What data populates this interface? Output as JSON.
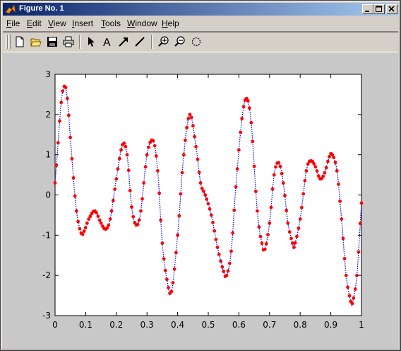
{
  "window": {
    "title": "Figure No. 1",
    "controls": [
      "minimize",
      "maximize",
      "close"
    ]
  },
  "menu": [
    {
      "label": "File",
      "mnemonic": "F",
      "rest": "ile"
    },
    {
      "label": "Edit",
      "mnemonic": "E",
      "rest": "dit"
    },
    {
      "label": "View",
      "mnemonic": "V",
      "rest": "iew"
    },
    {
      "label": "Insert",
      "mnemonic": "I",
      "rest": "nsert"
    },
    {
      "label": "Tools",
      "mnemonic": "T",
      "rest": "ools"
    },
    {
      "label": "Window",
      "mnemonic": "W",
      "rest": "indow"
    },
    {
      "label": "Help",
      "mnemonic": "H",
      "rest": "elp"
    }
  ],
  "toolbar": {
    "buttons": [
      "new-file-icon",
      "open-folder-icon",
      "save-icon",
      "print-icon",
      "select-arrow-icon",
      "insert-text-icon",
      "insert-arrow-icon",
      "insert-line-icon",
      "zoom-in-icon",
      "zoom-out-icon",
      "rotate-icon"
    ],
    "text_tool_glyph": "A"
  },
  "colors": {
    "marker": "#ff0000",
    "line": "#0000ff",
    "title_bar_start": "#0a246a",
    "title_bar_end": "#a6caf0",
    "face": "#d4d0c8",
    "figure_bg": "#c8c8c8"
  },
  "chart_data": {
    "type": "line",
    "xlim": [
      0,
      1
    ],
    "ylim": [
      -3,
      3
    ],
    "x_ticks": [
      "0",
      "0.1",
      "0.2",
      "0.3",
      "0.4",
      "0.5",
      "0.6",
      "0.7",
      "0.8",
      "0.9",
      "1"
    ],
    "y_ticks": [
      "3",
      "2",
      "1",
      "0",
      "-1",
      "-2",
      "-3"
    ],
    "grid": false,
    "series": [
      {
        "style": "blue dotted line with red circle markers",
        "x": [
          0.0,
          0.01,
          0.02,
          0.03,
          0.04,
          0.055,
          0.07,
          0.085,
          0.095,
          0.11,
          0.13,
          0.15,
          0.165,
          0.18,
          0.2,
          0.22,
          0.235,
          0.25,
          0.265,
          0.28,
          0.3,
          0.32,
          0.335,
          0.35,
          0.365,
          0.38,
          0.4,
          0.42,
          0.44,
          0.46,
          0.475,
          0.49,
          0.51,
          0.53,
          0.55,
          0.56,
          0.575,
          0.59,
          0.61,
          0.625,
          0.64,
          0.66,
          0.675,
          0.685,
          0.7,
          0.715,
          0.73,
          0.745,
          0.76,
          0.775,
          0.78,
          0.8,
          0.82,
          0.835,
          0.85,
          0.865,
          0.88,
          0.895,
          0.905,
          0.92,
          0.935,
          0.95,
          0.965,
          0.97,
          0.985,
          1.0
        ],
        "y": [
          0.3,
          1.3,
          2.3,
          2.7,
          2.4,
          0.9,
          -0.4,
          -0.95,
          -0.9,
          -0.6,
          -0.4,
          -0.7,
          -0.85,
          -0.6,
          0.4,
          1.25,
          1.0,
          -0.3,
          -0.75,
          -0.4,
          1.0,
          1.35,
          0.6,
          -1.2,
          -2.1,
          -2.4,
          -1.0,
          1.0,
          2.0,
          1.2,
          0.3,
          0.0,
          -0.5,
          -1.3,
          -1.9,
          -2.0,
          -1.4,
          0.2,
          1.9,
          2.4,
          1.8,
          -0.4,
          -1.2,
          -1.35,
          -0.7,
          0.5,
          0.8,
          0.3,
          -0.7,
          -1.2,
          -1.3,
          -0.6,
          0.6,
          0.85,
          0.7,
          0.4,
          0.55,
          0.95,
          1.0,
          0.6,
          -0.6,
          -2.0,
          -2.65,
          -2.7,
          -2.0,
          -0.2
        ]
      }
    ]
  }
}
